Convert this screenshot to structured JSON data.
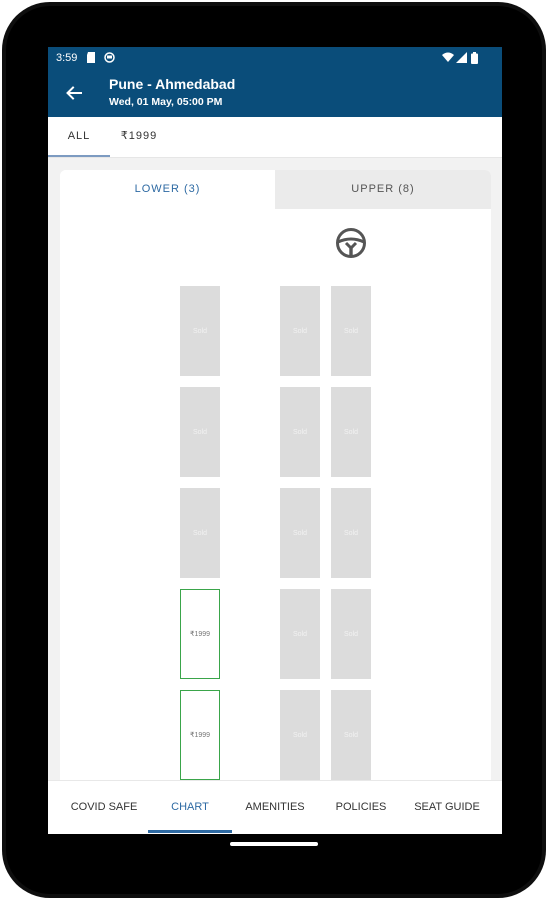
{
  "status": {
    "time": "3:59"
  },
  "header": {
    "route": "Pune - Ahmedabad",
    "datetime": "Wed, 01 May,  05:00 PM"
  },
  "filters": [
    {
      "label": "ALL",
      "active": true
    },
    {
      "label": "₹1999",
      "active": false
    }
  ],
  "deck_tabs": {
    "lower": "LOWER (3)",
    "upper": "UPPER (8)"
  },
  "seats": {
    "sold_label": "Sold",
    "price_label": "₹1999",
    "left_column": [
      "Sold",
      "Sold",
      "Sold",
      "₹1999",
      "₹1999"
    ],
    "middle_column": [
      "Sold",
      "Sold",
      "Sold",
      "Sold",
      "Sold"
    ],
    "right_column": [
      "Sold",
      "Sold",
      "Sold",
      "Sold",
      "Sold"
    ]
  },
  "bottom_nav": [
    {
      "label": "COVID SAFE",
      "active": false
    },
    {
      "label": "CHART",
      "active": true
    },
    {
      "label": "AMENITIES",
      "active": false
    },
    {
      "label": "POLICIES",
      "active": false
    },
    {
      "label": "SEAT GUIDE",
      "active": false
    }
  ],
  "colors": {
    "appbar": "#0a4d7a",
    "accent": "#2e6aa3",
    "available_border": "#3aa54a",
    "sold": "#dcdcdc"
  },
  "icons": [
    "back-arrow-icon",
    "steering-wheel-icon",
    "wifi-icon",
    "signal-icon",
    "battery-icon",
    "sd-card-icon",
    "notification-icon"
  ]
}
